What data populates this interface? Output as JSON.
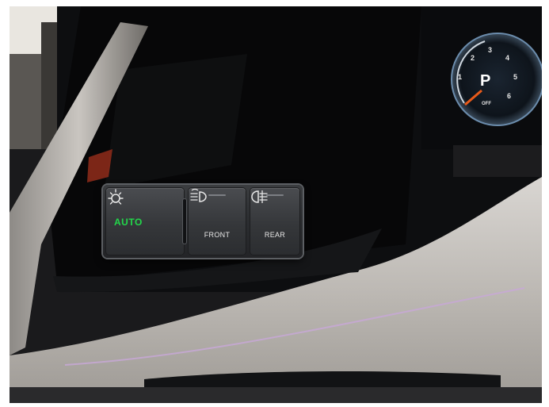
{
  "light_panel": {
    "auto_button": {
      "label": "AUTO",
      "icon": "auto-light-sun-icon",
      "label_color": "#22d84a"
    },
    "front_button": {
      "label": "FRONT",
      "icon": "front-fog-light-icon"
    },
    "rear_button": {
      "label": "REAR",
      "icon": "rear-fog-light-icon"
    }
  },
  "instrument_cluster": {
    "gear": "P",
    "ticks": [
      "1",
      "2",
      "3",
      "4",
      "5",
      "6"
    ],
    "off_label": "OFF"
  }
}
